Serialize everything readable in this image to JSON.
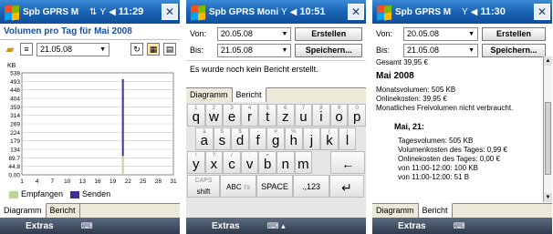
{
  "colors": {
    "title_bar": "#1a63b3",
    "heading": "#1b4f9c",
    "empfangen": "#b9d88f",
    "senden": "#3b2f8f"
  },
  "panel1": {
    "titlebar": {
      "app": "Spb GPRS M",
      "time": "11:29"
    },
    "heading": "Volumen pro Tag für Mai 2008",
    "date": "21.05.08",
    "tabs": [
      "Diagramm",
      "Bericht"
    ],
    "softkey_left": "Extras"
  },
  "chart_data": {
    "type": "bar",
    "title": "Volumen pro Tag für Mai 2008",
    "ylabel": "KB",
    "ylim": [
      0,
      538
    ],
    "y_ticks": [
      "538",
      "493",
      "448",
      "404",
      "359",
      "314",
      "269",
      "224",
      "179",
      "134",
      "89.7",
      "44.8",
      "0.00"
    ],
    "x_ticks": [
      "1",
      "4",
      "7",
      "10",
      "13",
      "16",
      "19",
      "22",
      "25",
      "28",
      "31"
    ],
    "xlim": [
      1,
      31
    ],
    "series": [
      {
        "name": "Empfangen",
        "x": [
          21
        ],
        "values": [
          100
        ]
      },
      {
        "name": "Senden",
        "x": [
          21
        ],
        "values": [
          405
        ]
      }
    ],
    "legend": [
      "Empfangen",
      "Senden"
    ]
  },
  "panel2": {
    "titlebar": {
      "app": "Spb GPRS Monit",
      "time": "10:51"
    },
    "von_label": "Von:",
    "von_value": "20.05.08",
    "bis_label": "Bis:",
    "bis_value": "21.05.08",
    "erstellen": "Erstellen",
    "speichern": "Speichern...",
    "message": "Es wurde noch kein Bericht erstellt.",
    "tabs": [
      "Diagramm",
      "Bericht"
    ],
    "softkey_left": "Extras",
    "keyboard": {
      "row1": [
        [
          "q",
          "1"
        ],
        [
          "w",
          "2"
        ],
        [
          "e",
          "3"
        ],
        [
          "r",
          "4"
        ],
        [
          "t",
          "5"
        ],
        [
          "z",
          "6"
        ],
        [
          "u",
          "7"
        ],
        [
          "i",
          "8"
        ],
        [
          "o",
          "9"
        ],
        [
          "p",
          "0"
        ]
      ],
      "row2": [
        [
          "a",
          "à"
        ],
        [
          "s",
          "ß"
        ],
        [
          "d",
          "$"
        ],
        [
          "f",
          "-"
        ],
        [
          "g",
          "#"
        ],
        [
          "h",
          "%"
        ],
        [
          "j",
          "'"
        ],
        [
          "k",
          "("
        ],
        [
          "l",
          ")"
        ]
      ],
      "row3": [
        [
          "y",
          "!"
        ],
        [
          "x",
          "?"
        ],
        [
          "c",
          "/"
        ],
        [
          "v",
          ":"
        ],
        [
          "b",
          "="
        ],
        [
          "n",
          ""
        ],
        [
          "m",
          ""
        ]
      ],
      "caps": "CAPS",
      "shift": "shift",
      "abc": "ABC",
      "t9": "T9",
      "space": "SPACE",
      "num": ".,123"
    }
  },
  "panel3": {
    "titlebar": {
      "app": "Spb GPRS M",
      "time": "11:30"
    },
    "von_label": "Von:",
    "von_value": "20.05.08",
    "bis_label": "Bis:",
    "bis_value": "21.05.08",
    "erstellen": "Erstellen",
    "speichern": "Speichern...",
    "gesamt": "Gesamt 39,95 €",
    "month": "Mai 2008",
    "monthly_volume": "Monatsvolumen: 505 KB",
    "online_costs": "Onlinekosten: 39,95 €",
    "free_volume": "Monatliches Freivolumen nicht verbraucht.",
    "day": "Mai, 21:",
    "day_volume": "Tagesvolumen: 505 KB",
    "day_costs": "Volumenkosten des Tages: 0,99 €",
    "day_online": "Onlinekosten des Tages: 0,00 €",
    "from1": "von 11:00-12:00: 100 KB",
    "from2": "von 11:00-12:00: 51 B",
    "tabs": [
      "Diagramm",
      "Bericht"
    ],
    "softkey_left": "Extras"
  }
}
